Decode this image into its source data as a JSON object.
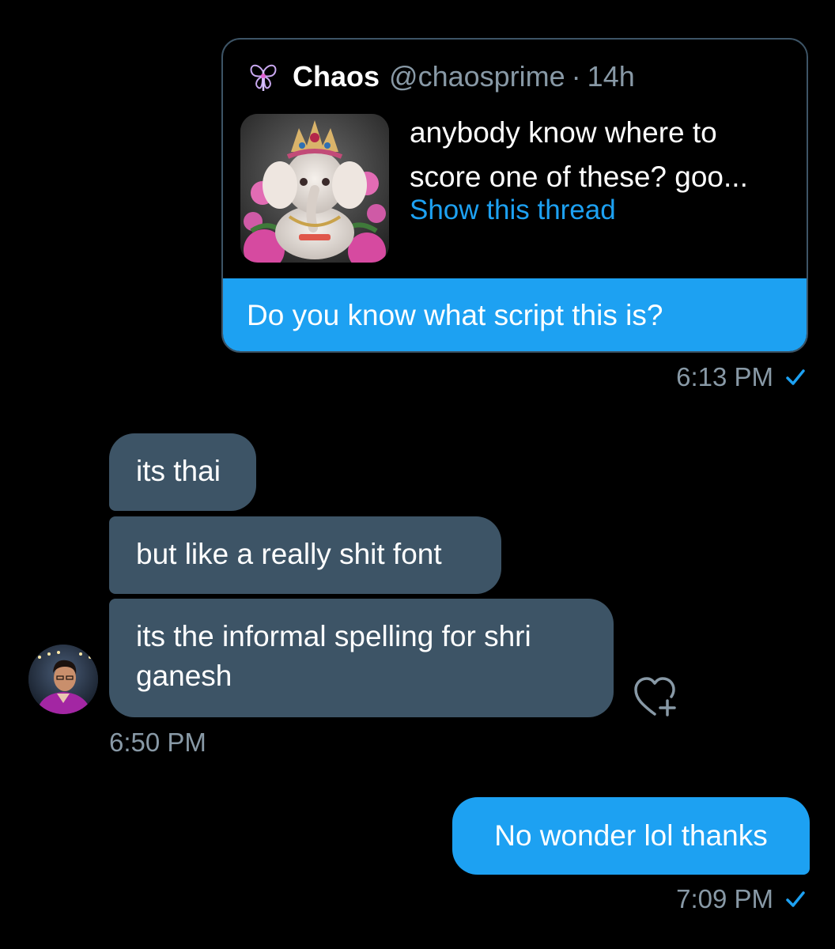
{
  "colors": {
    "background": "#000000",
    "accent": "#1da1f2",
    "received_bubble": "#3d5466",
    "secondary_text": "#8899a6"
  },
  "quoted_tweet": {
    "author_name": "Chaos",
    "author_handle": "@chaosprime",
    "separator": "·",
    "age": "14h",
    "text": "anybody know where to score one of these?  goo...",
    "show_thread_label": "Show this thread",
    "author_avatar_icon": "butterfly-icon",
    "thumbnail": "ganesha-statue-photo"
  },
  "messages": {
    "sent_1": {
      "text": "Do you know what script this is?",
      "time": "6:13 PM",
      "status_icon": "check-icon"
    },
    "received": {
      "bubbles": [
        "its thai",
        "but like a really shit font",
        "its the informal spelling for shri ganesh"
      ],
      "time": "6:50 PM",
      "avatar": "user-avatar",
      "reaction_icon": "heart-plus-icon"
    },
    "sent_2": {
      "text": "No wonder lol thanks",
      "time": "7:09 PM",
      "status_icon": "check-icon"
    }
  }
}
